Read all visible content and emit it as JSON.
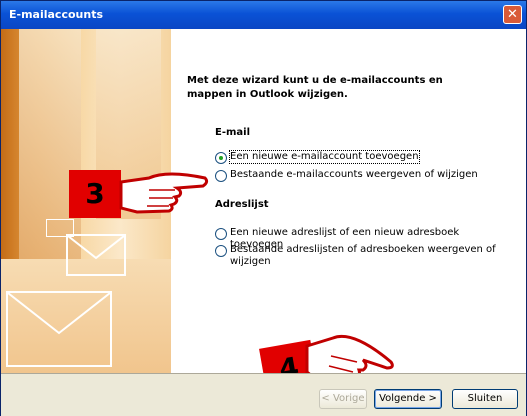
{
  "window": {
    "title": "E-mailaccounts",
    "close_glyph": "✕"
  },
  "wizard": {
    "intro": "Met deze wizard kunt u de e-mailaccounts en mappen in Outlook wijzigen."
  },
  "email_section": {
    "heading": "E-mail",
    "options": [
      {
        "label": "Een nieuwe e-mailaccount toevoegen",
        "selected": true
      },
      {
        "label": "Bestaande e-mailaccounts weergeven of wijzigen",
        "selected": false
      }
    ]
  },
  "address_section": {
    "heading": "Adreslijst",
    "options": [
      {
        "label": "Een nieuwe adreslijst of een nieuw adresboek toevoegen",
        "selected": false
      },
      {
        "label": "Bestaande adreslijsten of adresboeken weergeven of wijzigen",
        "selected": false
      }
    ]
  },
  "annotations": {
    "step3": "3",
    "step4": "4"
  },
  "buttons": {
    "back": "< Vorige",
    "next": "Volgende >",
    "close": "Sluiten"
  },
  "colors": {
    "titlebar": "#0a52d6",
    "annotation_red": "#e10000",
    "radio_dot": "#21a121"
  }
}
